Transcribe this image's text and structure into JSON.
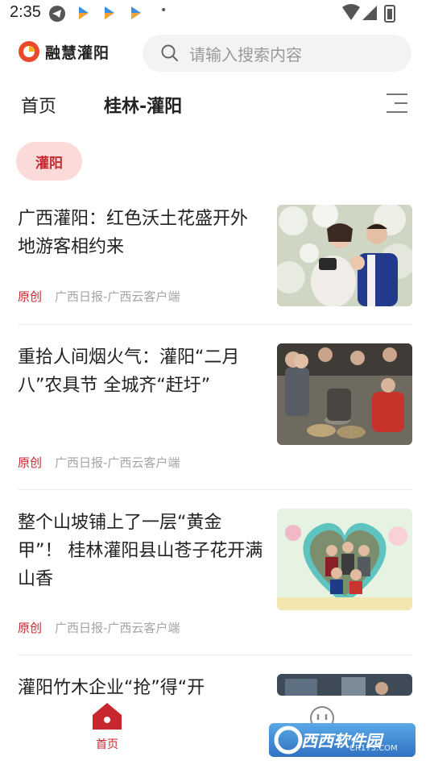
{
  "status_bar": {
    "time": "2:35",
    "dot": "•"
  },
  "header": {
    "logo_text": "融慧灌阳",
    "search_placeholder": "请输入搜索内容"
  },
  "tabs": [
    {
      "label": "首页",
      "active": false
    },
    {
      "label": "桂林-灌阳",
      "active": true
    }
  ],
  "chip": {
    "label": "灌阳"
  },
  "articles": [
    {
      "title": "广西灌阳：红色沃土花盛开外地游客相约来",
      "original": "原创",
      "source": "广西日报-广西云客户端",
      "image": "couple-photo-blossoms"
    },
    {
      "title": "重拾人间烟火气：灌阳“二月八”农具节 全城齐“赶圩”",
      "original": "原创",
      "source": "广西日报-广西云客户端",
      "image": "market-crowd"
    },
    {
      "title": "整个山坡铺上了一层“黄金甲”！ 桂林灌阳县山苍子花开满山香",
      "original": "原创",
      "source": "广西日报-广西云客户端",
      "image": "group-photo-heart-frame"
    },
    {
      "title": "灌阳竹木企业“抢”得“开",
      "original": "",
      "source": "",
      "image": "factory-scene"
    }
  ],
  "bottom_nav": {
    "home_label": "首页",
    "home_icon": "home-icon",
    "second_icon": "face-icon"
  },
  "watermark": {
    "text": "西西软件园",
    "sub": "CR173.COM"
  },
  "colors": {
    "accent": "#c8282d",
    "chip_bg": "#fbdada",
    "muted": "#a5a5a5"
  }
}
